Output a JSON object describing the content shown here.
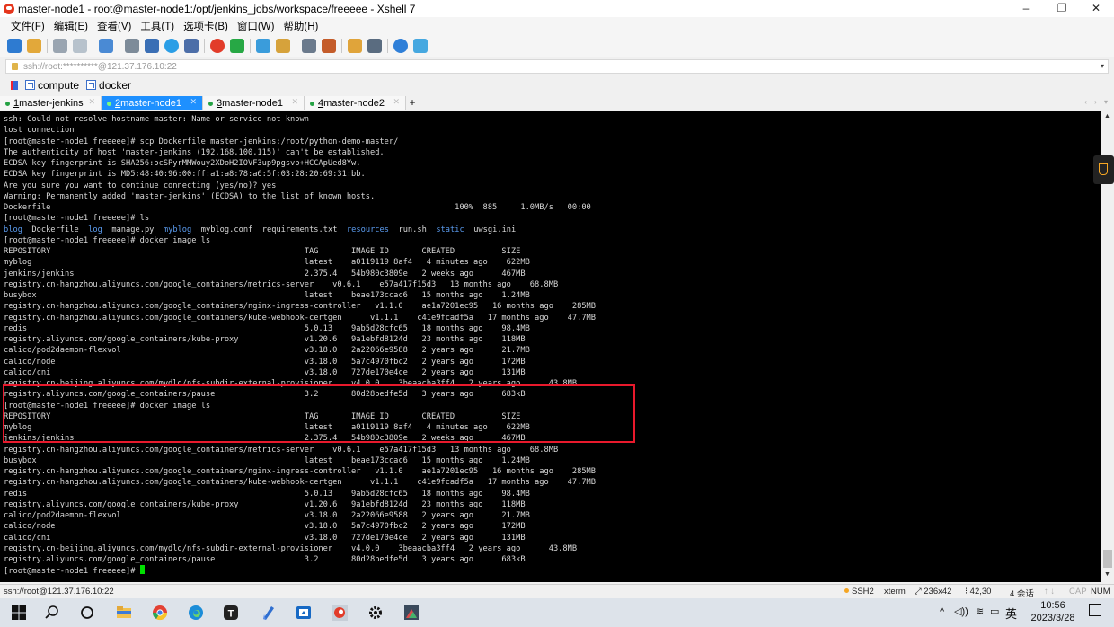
{
  "window": {
    "title": "master-node1 - root@master-node1:/opt/jenkins_jobs/workspace/freeeee - Xshell 7",
    "minimize": "–",
    "maximize": "❐",
    "close": "✕"
  },
  "menu": [
    "文件(F)",
    "编辑(E)",
    "查看(V)",
    "工具(T)",
    "选项卡(B)",
    "窗口(W)",
    "帮助(H)"
  ],
  "address": {
    "value": "ssh://root:**********@121.37.176.10:22",
    "dropdown": "▾"
  },
  "links": [
    {
      "label": "compute"
    },
    {
      "label": "docker"
    }
  ],
  "tabs": [
    {
      "num": "1",
      "label": " master-jenkins",
      "active": false
    },
    {
      "num": "2",
      "label": " master-node1",
      "active": true
    },
    {
      "num": "3",
      "label": " master-node1",
      "active": false
    },
    {
      "num": "4",
      "label": " master-node2",
      "active": false
    }
  ],
  "tab_add": "+",
  "tab_nav": "‹ › ▾",
  "terminal": {
    "lines": [
      "ssh: Could not resolve hostname master: Name or service not known",
      "lost connection",
      "[root@master-node1 freeeee]# scp Dockerfile master-jenkins:/root/python-demo-master/",
      "The authenticity of host 'master-jenkins (192.168.100.115)' can't be established.",
      "ECDSA key fingerprint is SHA256:ocSPyrMMWouy2XDoH2IOVF3up9pgsvb+HCCApUed8Yw.",
      "ECDSA key fingerprint is MD5:48:40:96:00:ff:a1:a8:78:a6:5f:03:28:20:69:31:bb.",
      "Are you sure you want to continue connecting (yes/no)? yes",
      "Warning: Permanently added 'master-jenkins' (ECDSA) to the list of known hosts.",
      "Dockerfile                                                                                      100%  885     1.0MB/s   00:00",
      "[root@master-node1 freeeee]# ls",
      "__LS__",
      "[root@master-node1 freeeee]# docker image ls",
      "REPOSITORY                                                      TAG       IMAGE ID       CREATED          SIZE",
      "myblog                                                          latest    a0119119 8af4   4 minutes ago    622MB",
      "jenkins/jenkins                                                 2.375.4   54b980c3809e   2 weeks ago      467MB",
      "registry.cn-hangzhou.aliyuncs.com/google_containers/metrics-server    v0.6.1    e57a417f15d3   13 months ago    68.8MB",
      "busybox                                                         latest    beae173ccac6   15 months ago    1.24MB",
      "registry.cn-hangzhou.aliyuncs.com/google_containers/nginx-ingress-controller   v1.1.0    ae1a7201ec95   16 months ago    285MB",
      "registry.cn-hangzhou.aliyuncs.com/google_containers/kube-webhook-certgen      v1.1.1    c41e9fcadf5a   17 months ago    47.7MB",
      "redis                                                           5.0.13    9ab5d28cfc65   18 months ago    98.4MB",
      "registry.aliyuncs.com/google_containers/kube-proxy              v1.20.6   9a1ebfd8124d   23 months ago    118MB",
      "calico/pod2daemon-flexvol                                       v3.18.0   2a22066e9588   2 years ago      21.7MB",
      "calico/node                                                     v3.18.0   5a7c4970fbc2   2 years ago      172MB",
      "calico/cni                                                      v3.18.0   727de170e4ce   2 years ago      131MB",
      "registry.cn-beijing.aliyuncs.com/mydlq/nfs-subdir-external-provisioner    v4.0.0    3beaacba3ff4   2 years ago      43.8MB",
      "registry.aliyuncs.com/google_containers/pause                   3.2       80d28bedfe5d   3 years ago      683kB",
      "[root@master-node1 freeeee]# docker image ls",
      "REPOSITORY                                                      TAG       IMAGE ID       CREATED          SIZE",
      "myblog                                                          latest    a0119119 8af4   4 minutes ago    622MB",
      "jenkins/jenkins                                                 2.375.4   54b980c3809e   2 weeks ago      467MB",
      "registry.cn-hangzhou.aliyuncs.com/google_containers/metrics-server    v0.6.1    e57a417f15d3   13 months ago    68.8MB",
      "busybox                                                         latest    beae173ccac6   15 months ago    1.24MB",
      "registry.cn-hangzhou.aliyuncs.com/google_containers/nginx-ingress-controller   v1.1.0    ae1a7201ec95   16 months ago    285MB",
      "registry.cn-hangzhou.aliyuncs.com/google_containers/kube-webhook-certgen      v1.1.1    c41e9fcadf5a   17 months ago    47.7MB",
      "redis                                                           5.0.13    9ab5d28cfc65   18 months ago    98.4MB",
      "registry.aliyuncs.com/google_containers/kube-proxy              v1.20.6   9a1ebfd8124d   23 months ago    118MB",
      "calico/pod2daemon-flexvol                                       v3.18.0   2a22066e9588   2 years ago      21.7MB",
      "calico/node                                                     v3.18.0   5a7c4970fbc2   2 years ago      172MB",
      "calico/cni                                                      v3.18.0   727de170e4ce   2 years ago      131MB",
      "registry.cn-beijing.aliyuncs.com/mydlq/nfs-subdir-external-provisioner    v4.0.0    3beaacba3ff4   2 years ago      43.8MB",
      "registry.aliyuncs.com/google_containers/pause                   3.2       80d28bedfe5d   3 years ago      683kB",
      "__PROMPT__"
    ],
    "ls_output": [
      {
        "text": "blog",
        "dir": true
      },
      {
        "text": "Dockerfile",
        "dir": false
      },
      {
        "text": "log",
        "dir": true
      },
      {
        "text": "manage.py",
        "dir": false
      },
      {
        "text": "myblog",
        "dir": true
      },
      {
        "text": "myblog.conf",
        "dir": false
      },
      {
        "text": "requirements.txt",
        "dir": false
      },
      {
        "text": "resources",
        "dir": true
      },
      {
        "text": "run.sh",
        "dir": false
      },
      {
        "text": "static",
        "dir": true
      },
      {
        "text": "uwsgi.ini",
        "dir": false
      }
    ],
    "prompt": "[root@master-node1 freeeee]# "
  },
  "status": {
    "connection": "ssh://root@121.37.176.10:22",
    "protocol": "SSH2",
    "term": "xterm",
    "size": "236x42",
    "pos": "42,30",
    "sessions": "4 会话",
    "caps": "CAP",
    "num": "NUM"
  },
  "taskbar": {
    "ime": "英",
    "time": "10:56",
    "date": "2023/3/28"
  },
  "colors": {
    "accent": "#1e90ff",
    "highlight_box": "#e8192c",
    "cursor": "#00e000",
    "dir": "#5b9cf0"
  }
}
